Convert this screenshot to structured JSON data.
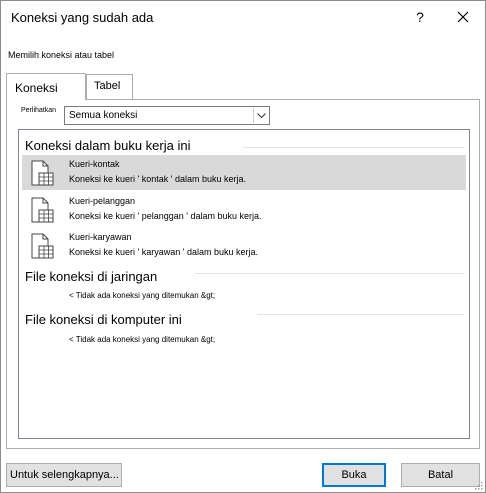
{
  "window": {
    "title": "Koneksi yang sudah ada",
    "help_label": "?",
    "close_icon": "close-icon"
  },
  "subtitle": "Memilih koneksi atau tabel",
  "tabs": [
    {
      "label": "Koneksi",
      "selected": true
    },
    {
      "label": "Tabel",
      "selected": false
    }
  ],
  "show": {
    "label": "Perlihatkan",
    "value": "Semua koneksi"
  },
  "groups": {
    "workbook": {
      "header": "Koneksi dalam buku kerja ini",
      "items": [
        {
          "name": "Kueri-kontak",
          "desc": "Koneksi ke kueri ' kontak ' dalam buku kerja.",
          "selected": true
        },
        {
          "name": "Kueri-pelanggan",
          "desc": "Koneksi ke kueri ' pelanggan ' dalam buku kerja.",
          "selected": false
        },
        {
          "name": "Kueri-karyawan",
          "desc": "Koneksi ke kueri ' karyawan ' dalam buku kerja.",
          "selected": false
        }
      ]
    },
    "network": {
      "header": "File koneksi di jaringan",
      "empty": "< Tidak ada koneksi yang ditemukan &gt;"
    },
    "computer": {
      "header": "File koneksi di komputer ini",
      "empty": "< Tidak ada koneksi yang ditemukan &gt;"
    }
  },
  "buttons": {
    "more": "Untuk selengkapnya...",
    "open": "Buka",
    "cancel": "Batal"
  },
  "colors": {
    "selected_row": "#d9d9d9",
    "default_button_border": "#0078d7",
    "button_face": "#e1e1e1"
  }
}
